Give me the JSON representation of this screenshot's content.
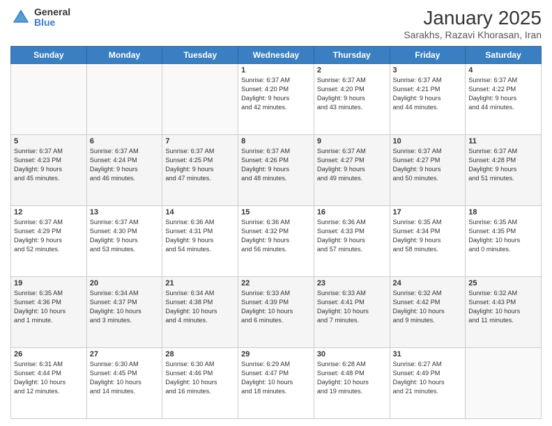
{
  "logo": {
    "general": "General",
    "blue": "Blue"
  },
  "title": "January 2025",
  "subtitle": "Sarakhs, Razavi Khorasan, Iran",
  "weekdays": [
    "Sunday",
    "Monday",
    "Tuesday",
    "Wednesday",
    "Thursday",
    "Friday",
    "Saturday"
  ],
  "weeks": [
    [
      {
        "day": "",
        "detail": ""
      },
      {
        "day": "",
        "detail": ""
      },
      {
        "day": "",
        "detail": ""
      },
      {
        "day": "1",
        "detail": "Sunrise: 6:37 AM\nSunset: 4:20 PM\nDaylight: 9 hours\nand 42 minutes."
      },
      {
        "day": "2",
        "detail": "Sunrise: 6:37 AM\nSunset: 4:20 PM\nDaylight: 9 hours\nand 43 minutes."
      },
      {
        "day": "3",
        "detail": "Sunrise: 6:37 AM\nSunset: 4:21 PM\nDaylight: 9 hours\nand 44 minutes."
      },
      {
        "day": "4",
        "detail": "Sunrise: 6:37 AM\nSunset: 4:22 PM\nDaylight: 9 hours\nand 44 minutes."
      }
    ],
    [
      {
        "day": "5",
        "detail": "Sunrise: 6:37 AM\nSunset: 4:23 PM\nDaylight: 9 hours\nand 45 minutes."
      },
      {
        "day": "6",
        "detail": "Sunrise: 6:37 AM\nSunset: 4:24 PM\nDaylight: 9 hours\nand 46 minutes."
      },
      {
        "day": "7",
        "detail": "Sunrise: 6:37 AM\nSunset: 4:25 PM\nDaylight: 9 hours\nand 47 minutes."
      },
      {
        "day": "8",
        "detail": "Sunrise: 6:37 AM\nSunset: 4:26 PM\nDaylight: 9 hours\nand 48 minutes."
      },
      {
        "day": "9",
        "detail": "Sunrise: 6:37 AM\nSunset: 4:27 PM\nDaylight: 9 hours\nand 49 minutes."
      },
      {
        "day": "10",
        "detail": "Sunrise: 6:37 AM\nSunset: 4:27 PM\nDaylight: 9 hours\nand 50 minutes."
      },
      {
        "day": "11",
        "detail": "Sunrise: 6:37 AM\nSunset: 4:28 PM\nDaylight: 9 hours\nand 51 minutes."
      }
    ],
    [
      {
        "day": "12",
        "detail": "Sunrise: 6:37 AM\nSunset: 4:29 PM\nDaylight: 9 hours\nand 52 minutes."
      },
      {
        "day": "13",
        "detail": "Sunrise: 6:37 AM\nSunset: 4:30 PM\nDaylight: 9 hours\nand 53 minutes."
      },
      {
        "day": "14",
        "detail": "Sunrise: 6:36 AM\nSunset: 4:31 PM\nDaylight: 9 hours\nand 54 minutes."
      },
      {
        "day": "15",
        "detail": "Sunrise: 6:36 AM\nSunset: 4:32 PM\nDaylight: 9 hours\nand 56 minutes."
      },
      {
        "day": "16",
        "detail": "Sunrise: 6:36 AM\nSunset: 4:33 PM\nDaylight: 9 hours\nand 57 minutes."
      },
      {
        "day": "17",
        "detail": "Sunrise: 6:35 AM\nSunset: 4:34 PM\nDaylight: 9 hours\nand 58 minutes."
      },
      {
        "day": "18",
        "detail": "Sunrise: 6:35 AM\nSunset: 4:35 PM\nDaylight: 10 hours\nand 0 minutes."
      }
    ],
    [
      {
        "day": "19",
        "detail": "Sunrise: 6:35 AM\nSunset: 4:36 PM\nDaylight: 10 hours\nand 1 minute."
      },
      {
        "day": "20",
        "detail": "Sunrise: 6:34 AM\nSunset: 4:37 PM\nDaylight: 10 hours\nand 3 minutes."
      },
      {
        "day": "21",
        "detail": "Sunrise: 6:34 AM\nSunset: 4:38 PM\nDaylight: 10 hours\nand 4 minutes."
      },
      {
        "day": "22",
        "detail": "Sunrise: 6:33 AM\nSunset: 4:39 PM\nDaylight: 10 hours\nand 6 minutes."
      },
      {
        "day": "23",
        "detail": "Sunrise: 6:33 AM\nSunset: 4:41 PM\nDaylight: 10 hours\nand 7 minutes."
      },
      {
        "day": "24",
        "detail": "Sunrise: 6:32 AM\nSunset: 4:42 PM\nDaylight: 10 hours\nand 9 minutes."
      },
      {
        "day": "25",
        "detail": "Sunrise: 6:32 AM\nSunset: 4:43 PM\nDaylight: 10 hours\nand 11 minutes."
      }
    ],
    [
      {
        "day": "26",
        "detail": "Sunrise: 6:31 AM\nSunset: 4:44 PM\nDaylight: 10 hours\nand 12 minutes."
      },
      {
        "day": "27",
        "detail": "Sunrise: 6:30 AM\nSunset: 4:45 PM\nDaylight: 10 hours\nand 14 minutes."
      },
      {
        "day": "28",
        "detail": "Sunrise: 6:30 AM\nSunset: 4:46 PM\nDaylight: 10 hours\nand 16 minutes."
      },
      {
        "day": "29",
        "detail": "Sunrise: 6:29 AM\nSunset: 4:47 PM\nDaylight: 10 hours\nand 18 minutes."
      },
      {
        "day": "30",
        "detail": "Sunrise: 6:28 AM\nSunset: 4:48 PM\nDaylight: 10 hours\nand 19 minutes."
      },
      {
        "day": "31",
        "detail": "Sunrise: 6:27 AM\nSunset: 4:49 PM\nDaylight: 10 hours\nand 21 minutes."
      },
      {
        "day": "",
        "detail": ""
      }
    ]
  ]
}
